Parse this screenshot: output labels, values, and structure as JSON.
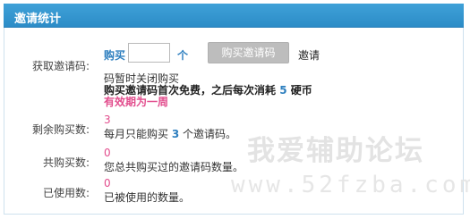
{
  "header": {
    "title": "邀请统计"
  },
  "get_code": {
    "label": "获取邀请码:",
    "buy_label": "购买",
    "input_value": "",
    "unit": "个",
    "buy_button": "购买邀请码",
    "invite_link": "邀请"
  },
  "notice": {
    "line1": "码暂时关闭购买",
    "line2_prefix": "购买邀请码首次免费，之后每次消耗",
    "line2_num": "5",
    "line2_suffix": "硬币",
    "line3": "有效期为一周"
  },
  "remaining": {
    "label": "剩余购买数:",
    "value": "3",
    "desc_prefix": "每月只能购买",
    "desc_num": "3",
    "desc_suffix": "个邀请码。"
  },
  "total": {
    "label": "共购买数:",
    "value": "0",
    "desc": "您总共购买过的邀请码数量。"
  },
  "used": {
    "label": "已使用数:",
    "value": "0",
    "desc": "已被使用的数量。"
  },
  "watermark": {
    "title": "我爱辅助论坛",
    "url": "www.52fzba.com"
  }
}
